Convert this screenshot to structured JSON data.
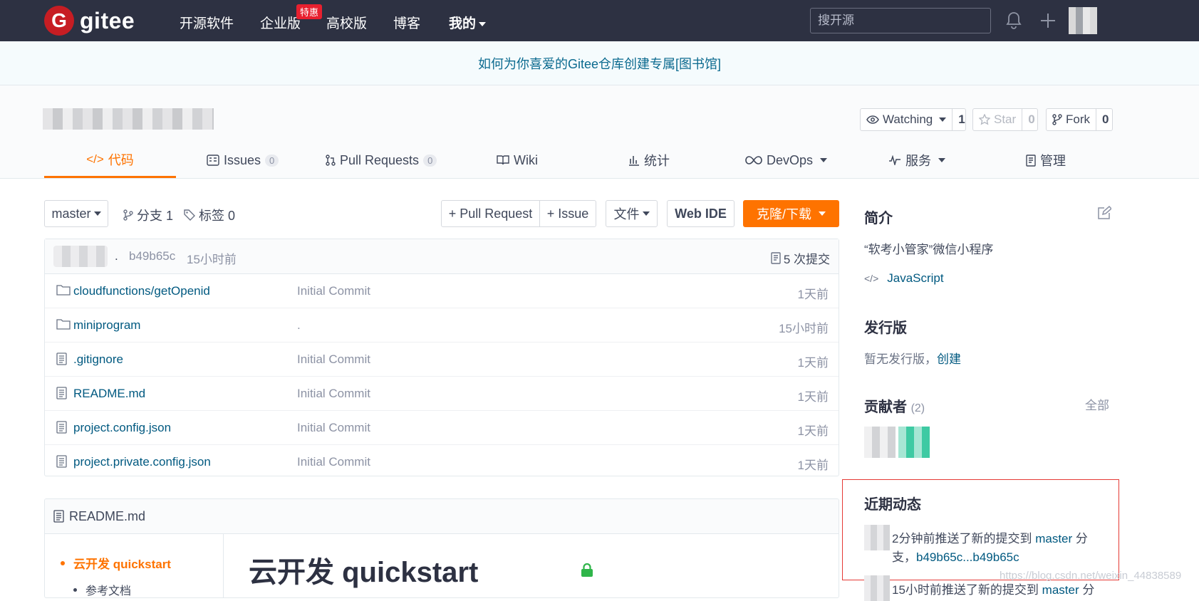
{
  "nav": {
    "logo_letter": "G",
    "logo_text": "gitee",
    "links": [
      "开源软件",
      "企业版",
      "高校版",
      "博客",
      "我的"
    ],
    "enterprise_badge": "特惠",
    "search_placeholder": "搜开源"
  },
  "banner": {
    "text": "如何为你喜爱的Gitee仓库创建专属[图书馆]"
  },
  "repo": {
    "actions": [
      {
        "label": "Watching",
        "count": "1"
      },
      {
        "label": "Star",
        "count": "0"
      },
      {
        "label": "Fork",
        "count": "0"
      }
    ],
    "tabs": [
      {
        "label": "代码",
        "count": ""
      },
      {
        "label": "Issues",
        "count": "0"
      },
      {
        "label": "Pull Requests",
        "count": "0"
      },
      {
        "label": "Wiki",
        "count": ""
      },
      {
        "label": "统计",
        "count": ""
      },
      {
        "label": "DevOps",
        "count": ""
      },
      {
        "label": "服务",
        "count": ""
      },
      {
        "label": "管理",
        "count": ""
      }
    ]
  },
  "toolbar": {
    "branch": "master",
    "branches": "分支 1",
    "tags": "标签 0",
    "pull_request": "+ Pull Request",
    "issue": "+ Issue",
    "files": "文件",
    "web_ide": "Web IDE",
    "clone": "克隆/下载"
  },
  "commit": {
    "message": ".",
    "hash": "b49b65c",
    "time": "15小时前",
    "count": "5 次提交"
  },
  "files": [
    {
      "type": "folder",
      "name_prefix": "cloudfunctions/",
      "name": "getOpenid",
      "message": "Initial Commit",
      "time": "1天前"
    },
    {
      "type": "folder",
      "name_prefix": "",
      "name": "miniprogram",
      "message": ".",
      "time": "15小时前"
    },
    {
      "type": "file",
      "name_prefix": "",
      "name": ".gitignore",
      "message": "Initial Commit",
      "time": "1天前"
    },
    {
      "type": "file",
      "name_prefix": "",
      "name": "README.md",
      "message": "Initial Commit",
      "time": "1天前"
    },
    {
      "type": "file",
      "name_prefix": "",
      "name": "project.config.json",
      "message": "Initial Commit",
      "time": "1天前"
    },
    {
      "type": "file",
      "name_prefix": "",
      "name": "project.private.config.json",
      "message": "Initial Commit",
      "time": "1天前"
    }
  ],
  "readme": {
    "filename": "README.md",
    "toc_main": "云开发 quickstart",
    "toc_sub": "参考文档",
    "title": "云开发 quickstart"
  },
  "sidebar": {
    "intro_title": "简介",
    "intro_text": "“软考小管家”微信小程序",
    "language": "JavaScript",
    "release_title": "发行版",
    "release_text": "暂无发行版，",
    "release_create": "创建",
    "contrib_title": "贡献者",
    "contrib_count": "(2)",
    "contrib_all": "全部",
    "activity_title": "近期动态",
    "activity1_text": "2分钟前推送了新的提交到",
    "activity1_branch": "master",
    "activity1_tail": "分支，",
    "activity1_link": "b49b65c...b49b65c",
    "activity2_text": "15小时前推送了新的提交到",
    "activity2_branch": "master",
    "activity2_tail": "分"
  },
  "watermark": "https://blog.csdn.net/weixin_44838589"
}
